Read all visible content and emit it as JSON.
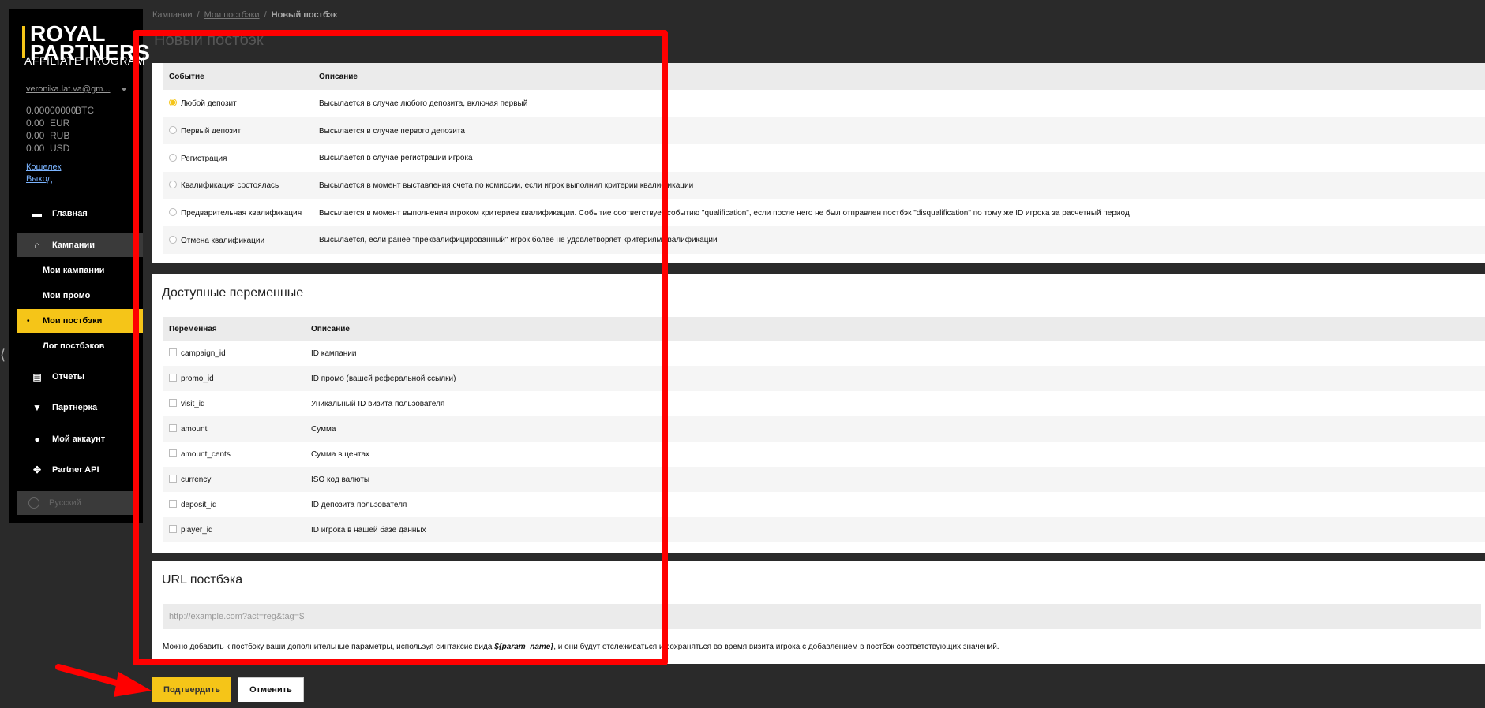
{
  "logo": {
    "line1": "ROYAL",
    "line2": "PARTNERS",
    "line3": "AFFILIATE PROGRAM"
  },
  "user": {
    "email": "veronika.lat.va@gm...",
    "balances": [
      {
        "amount": "0.00000000",
        "currency": "BTC"
      },
      {
        "amount": "0.00",
        "currency": "EUR"
      },
      {
        "amount": "0.00",
        "currency": "RUB"
      },
      {
        "amount": "0.00",
        "currency": "USD"
      }
    ],
    "wallet_link": "Кошелек",
    "logout_link": "Выход"
  },
  "nav": {
    "home": "Главная",
    "campaigns": "Кампании",
    "my_campaigns": "Мои кампании",
    "my_promo": "Мои промо",
    "my_postbacks": "Мои постбэки",
    "postback_log": "Лог постбэков",
    "reports": "Отчеты",
    "partner": "Партнерка",
    "account": "Мой аккаунт",
    "partner_api": "Partner API",
    "language": "Русский"
  },
  "breadcrumb": {
    "campaigns": "Кампании",
    "postbacks": "Мои постбэки",
    "current": "Новый постбэк"
  },
  "page_title": "Новый постбэк",
  "events": {
    "header_event": "Событие",
    "header_desc": "Описание",
    "rows": [
      {
        "event": "Любой депозит",
        "desc": "Высылается в случае любого депозита, включая первый",
        "selected": true
      },
      {
        "event": "Первый депозит",
        "desc": "Высылается в случае первого депозита",
        "selected": false
      },
      {
        "event": "Регистрация",
        "desc": "Высылается в случае регистрации игрока",
        "selected": false
      },
      {
        "event": "Квалификация состоялась",
        "desc": "Высылается в момент выставления счета по комиссии, если игрок выполнил критерии квалификации",
        "selected": false
      },
      {
        "event": "Предварительная квалификация",
        "desc": "Высылается в момент выполнения игроком критериев квалификации. Событие соответствует событию \"qualification\", если после него не был отправлен постбэк \"disqualification\" по тому же ID игрока за расчетный период",
        "selected": false
      },
      {
        "event": "Отмена квалификации",
        "desc": "Высылается, если ранее \"преквалифицированный\" игрок более не удовлетворяет критериям квалификации",
        "selected": false
      }
    ]
  },
  "variables": {
    "title": "Доступные переменные",
    "header_var": "Переменная",
    "header_desc": "Описание",
    "rows": [
      {
        "name": "campaign_id",
        "desc": "ID кампании"
      },
      {
        "name": "promo_id",
        "desc": "ID промо (вашей реферальной ссылки)"
      },
      {
        "name": "visit_id",
        "desc": "Уникальный ID визита пользователя"
      },
      {
        "name": "amount",
        "desc": "Сумма"
      },
      {
        "name": "amount_cents",
        "desc": "Сумма в центах"
      },
      {
        "name": "currency",
        "desc": "ISO код валюты"
      },
      {
        "name": "deposit_id",
        "desc": "ID депозита пользователя"
      },
      {
        "name": "player_id",
        "desc": "ID игрока в нашей базе данных"
      }
    ]
  },
  "url_section": {
    "title": "URL постбэка",
    "placeholder": "http://example.com?act=reg&tag=$",
    "help_before": "Можно добавить к постбэку ваши дополнительные параметры, используя синтаксис вида ",
    "help_code": "${param_name}",
    "help_after": ", и они будут отслеживаться и сохраняться во время визита игрока с добавлением в постбэк соответствующих значений."
  },
  "buttons": {
    "confirm": "Подтвердить",
    "cancel": "Отменить"
  },
  "colors": {
    "accent": "#f5c518",
    "annotation": "#ff0000"
  }
}
